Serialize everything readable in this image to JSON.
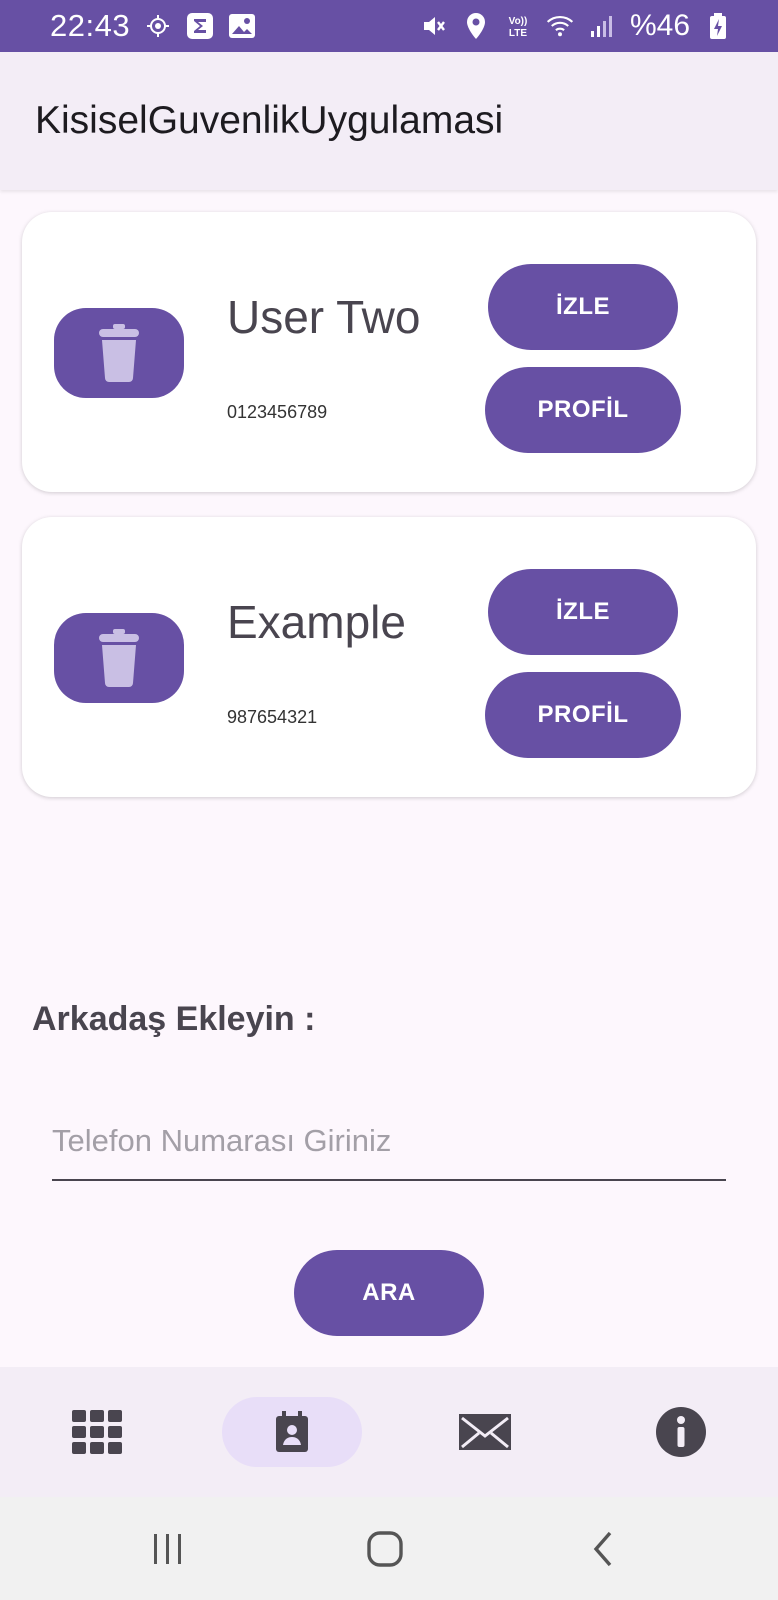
{
  "status_bar": {
    "time": "22:43",
    "battery": "%46",
    "left_icons": [
      "location-target-icon",
      "sigma-app-icon",
      "gallery-icon"
    ],
    "right_icons": [
      "mute-icon",
      "location-icon",
      "volte-icon",
      "wifi-icon",
      "signal-icon",
      "battery-charging-icon"
    ]
  },
  "app_bar": {
    "title": "KisiselGuvenlikUygulamasi"
  },
  "contacts": [
    {
      "name": "User Two",
      "phone": "0123456789",
      "watch_label": "İZLE",
      "profile_label": "PROFİL"
    },
    {
      "name": "Example",
      "phone": "987654321",
      "watch_label": "İZLE",
      "profile_label": "PROFİL"
    }
  ],
  "add_friend": {
    "title": "Arkadaş Ekleyin :",
    "placeholder": "Telefon Numarası Giriniz",
    "value": "",
    "search_label": "ARA"
  },
  "bottom_nav": {
    "items": [
      "grid-icon",
      "contacts-icon",
      "mail-icon",
      "info-icon"
    ],
    "active": "contacts-icon"
  },
  "colors": {
    "primary": "#6750a4",
    "surface": "#fdf7fd",
    "app_bar": "#f3edf6",
    "nav_indicator": "#e8def8"
  }
}
